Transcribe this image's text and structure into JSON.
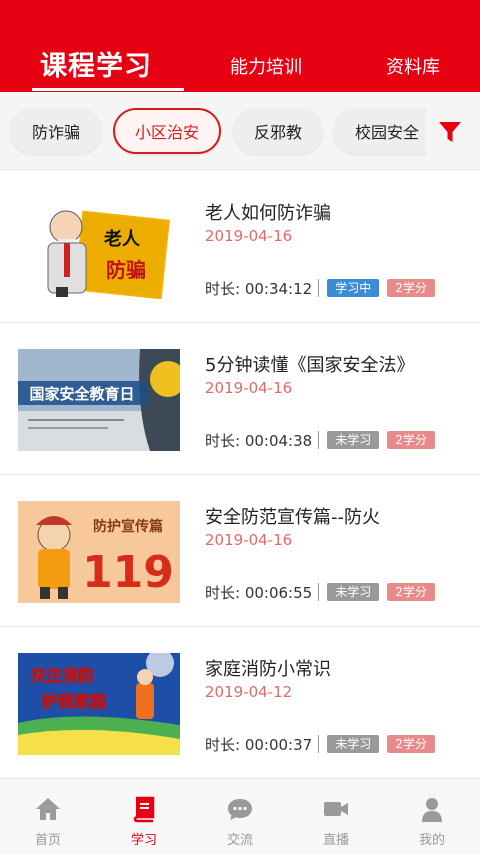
{
  "header": {
    "tabs": [
      {
        "label": "课程学习",
        "active": true
      },
      {
        "label": "能力培训",
        "active": false
      },
      {
        "label": "资料库",
        "active": false
      }
    ]
  },
  "categories": {
    "items": [
      {
        "label": "防诈骗",
        "active": false
      },
      {
        "label": "小区治安",
        "active": true
      },
      {
        "label": "反邪教",
        "active": false
      },
      {
        "label": "校园安全",
        "active": false
      }
    ],
    "filter_icon": "filter-funnel-icon"
  },
  "courses": [
    {
      "title": "老人如何防诈骗",
      "date": "2019-04-16",
      "duration": "时长: 00:34:12",
      "status": "学习中",
      "credit": "2学分",
      "thumb_text": [
        "老人",
        "防骗"
      ]
    },
    {
      "title": "5分钟读懂《国家安全法》",
      "date": "2019-04-16",
      "duration": "时长: 00:04:38",
      "status": "未学习",
      "credit": "2学分",
      "thumb_text": [
        "国家安全教育日"
      ]
    },
    {
      "title": "安全防范宣传篇--防火",
      "date": "2019-04-16",
      "duration": "时长: 00:06:55",
      "status": "未学习",
      "credit": "2学分",
      "thumb_text": [
        "防护宣传篇",
        "119"
      ]
    },
    {
      "title": "家庭消防小常识",
      "date": "2019-04-12",
      "duration": "时长: 00:00:37",
      "status": "未学习",
      "credit": "2学分",
      "thumb_text": [
        "关注消防",
        "护我家园"
      ]
    }
  ],
  "bottom_nav": [
    {
      "label": "首页",
      "icon": "home-icon",
      "active": false
    },
    {
      "label": "学习",
      "icon": "book-icon",
      "active": true
    },
    {
      "label": "交流",
      "icon": "chat-bubble-icon",
      "active": false
    },
    {
      "label": "直播",
      "icon": "video-camera-icon",
      "active": false
    },
    {
      "label": "我的",
      "icon": "person-icon",
      "active": false
    }
  ],
  "colors": {
    "brand_red": "#e60012",
    "status_active": "#3b8bd9",
    "status_inactive": "#999999",
    "credit": "#e68a8a",
    "date": "#e06a6a"
  }
}
